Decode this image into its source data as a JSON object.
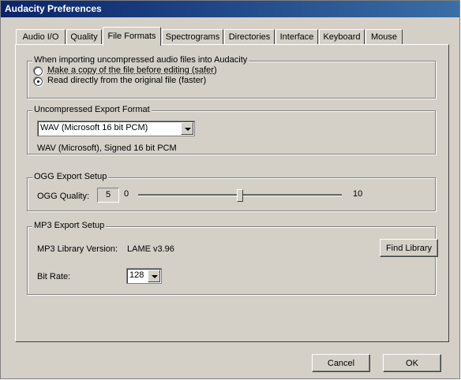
{
  "window": {
    "title": "Audacity Preferences"
  },
  "tabs": [
    {
      "label": "Audio I/O",
      "active": false
    },
    {
      "label": "Quality",
      "active": false
    },
    {
      "label": "File Formats",
      "active": true
    },
    {
      "label": "Spectrograms",
      "active": false
    },
    {
      "label": "Directories",
      "active": false
    },
    {
      "label": "Interface",
      "active": false
    },
    {
      "label": "Keyboard",
      "active": false
    },
    {
      "label": "Mouse",
      "active": false
    }
  ],
  "import_group": {
    "title": "When importing uncompressed audio files into Audacity",
    "options": [
      {
        "label": "Make a copy of the file before editing (safer)",
        "checked": false
      },
      {
        "label": "Read directly from the original file (faster)",
        "checked": true
      }
    ]
  },
  "export_group": {
    "title": "Uncompressed Export Format",
    "format_value": "WAV (Microsoft 16 bit PCM)",
    "format_description": "WAV (Microsoft), Signed 16 bit PCM"
  },
  "ogg_group": {
    "title": "OGG Export Setup",
    "quality_label": "OGG Quality:",
    "quality_value": "5",
    "slider_min": "0",
    "slider_max": "10",
    "slider_fraction": 0.5
  },
  "mp3_group": {
    "title": "MP3 Export Setup",
    "library_label": "MP3 Library Version:",
    "library_value": "LAME v3.96",
    "find_library_label": "Find Library",
    "bitrate_label": "Bit Rate:",
    "bitrate_value": "128"
  },
  "footer": {
    "cancel_label": "Cancel",
    "ok_label": "OK"
  }
}
